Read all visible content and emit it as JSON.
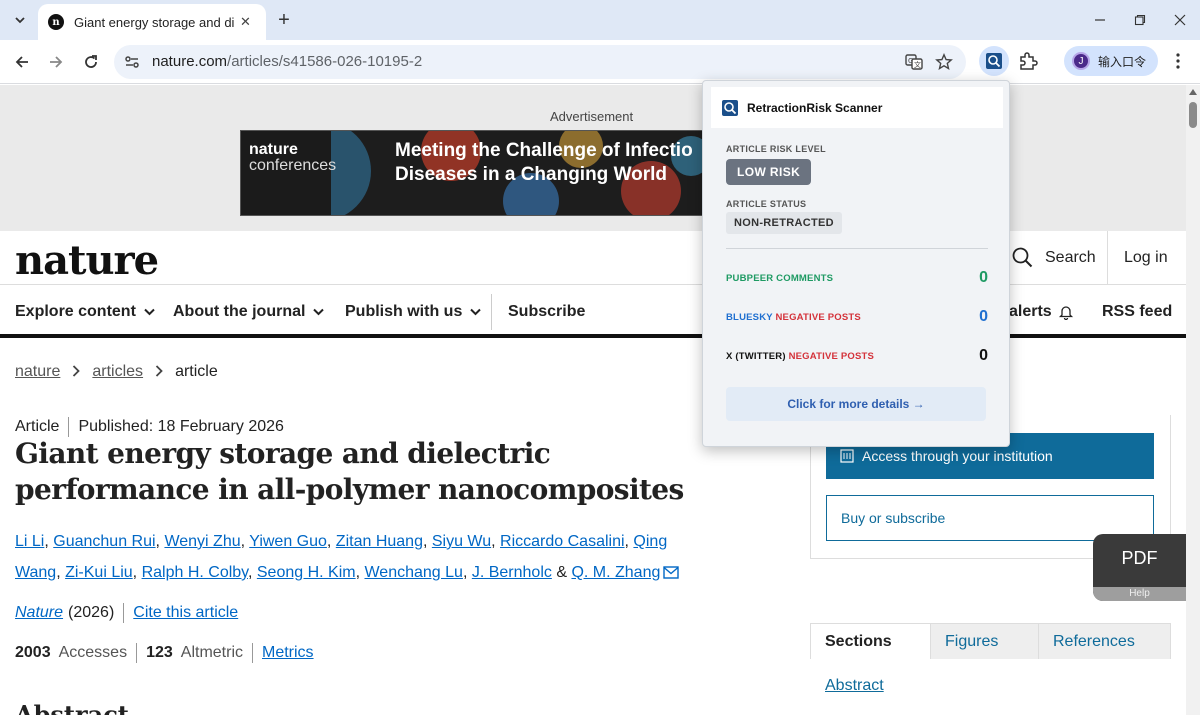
{
  "browser": {
    "tab_title": "Giant energy storage and die",
    "url_host": "nature.com",
    "url_path": "/articles/s41586-026-10195-2",
    "profile_label": "输入口令",
    "profile_initial": "J",
    "favicon_letter": "n"
  },
  "ad": {
    "label": "Advertisement",
    "logo_line1": "nature",
    "logo_line2": "conferences",
    "headline_line1": "Meeting the Challenge of Infectio",
    "headline_line2": "Diseases in a Changing World"
  },
  "header": {
    "logo": "nature",
    "search_label": "Search",
    "login_label": "Log in"
  },
  "nav": {
    "items": [
      "Explore content",
      "About the journal",
      "Publish with us"
    ],
    "subscribe": "Subscribe",
    "alerts": "alerts",
    "rss": "RSS feed"
  },
  "breadcrumb": {
    "items": [
      "nature",
      "articles"
    ],
    "current": "article"
  },
  "article": {
    "type": "Article",
    "published": "Published: 18 February 2026",
    "title": "Giant energy storage and dielectric performance in all-polymer nanocomposites",
    "authors": [
      "Li Li",
      "Guanchun Rui",
      "Wenyi Zhu",
      "Yiwen Guo",
      "Zitan Huang",
      "Siyu Wu",
      "Riccardo Casalini",
      "Qing Wang",
      "Zi-Kui Liu",
      "Ralph H. Colby",
      "Seong H. Kim",
      "Wenchang Lu",
      "J. Bernholc"
    ],
    "last_author": "Q. M. Zhang",
    "and": "&",
    "journal": "Nature",
    "year": "(2026)",
    "cite": "Cite this article",
    "accesses_value": "2003",
    "accesses_label": "Accesses",
    "altmetric_value": "123",
    "altmetric_label": "Altmetric",
    "metrics_link": "Metrics",
    "abstract_heading": "Abstract"
  },
  "sidebar": {
    "access_button": "Access through your institution",
    "buy_button": "Buy or subscribe",
    "pdf_label": "PDF",
    "pdf_help": "Help",
    "tabs": [
      "Sections",
      "Figures",
      "References"
    ],
    "first_section": "Abstract"
  },
  "extension": {
    "title": "RetractionRisk Scanner",
    "risk_label": "ARTICLE RISK LEVEL",
    "risk_value": "LOW RISK",
    "status_label": "ARTICLE STATUS",
    "status_value": "NON-RETRACTED",
    "pubpeer_label": "PUBPEER COMMENTS",
    "pubpeer_value": "0",
    "bluesky_prefix": "BLUESKY",
    "bluesky_suffix": "NEGATIVE POSTS",
    "bluesky_value": "0",
    "x_prefix": "X (TWITTER)",
    "x_suffix": "NEGATIVE POSTS",
    "x_value": "0",
    "details_button": "Click for more details →",
    "colors": {
      "pubpeer": "#1e9a63",
      "bluesky": "#1f6fd0",
      "negative": "#d4323a"
    }
  }
}
